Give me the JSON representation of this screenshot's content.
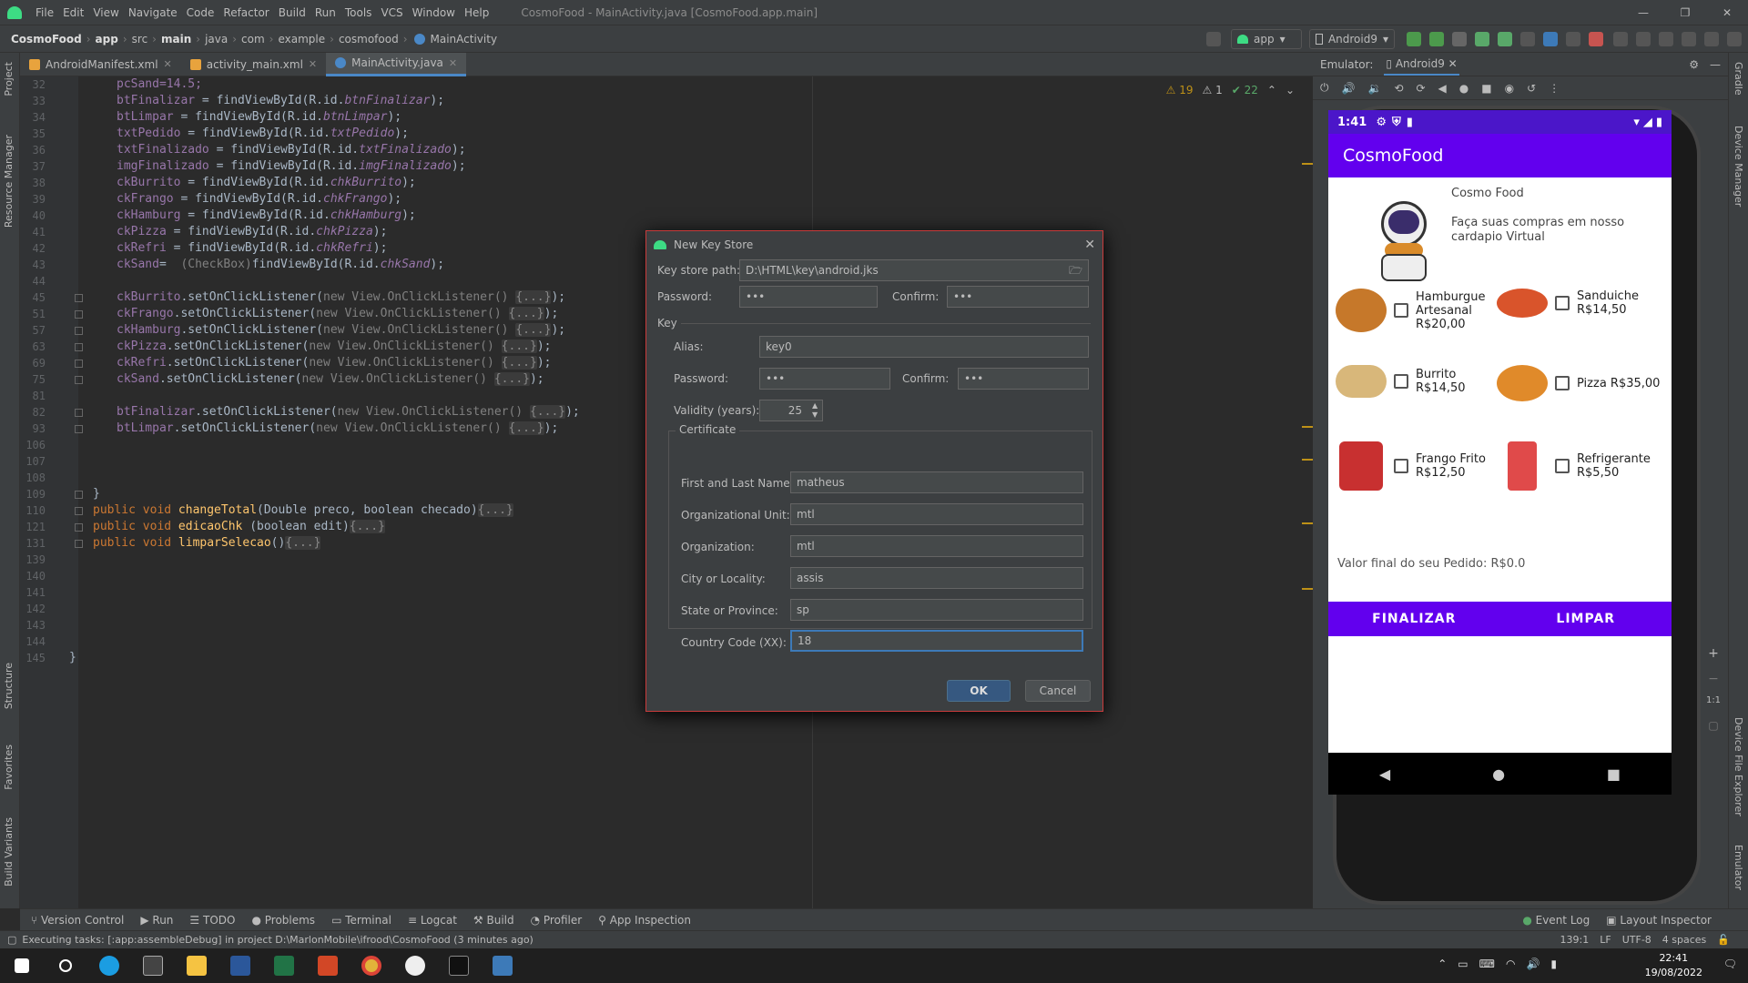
{
  "menubar": {
    "items": [
      "File",
      "Edit",
      "View",
      "Navigate",
      "Code",
      "Refactor",
      "Build",
      "Run",
      "Tools",
      "VCS",
      "Window",
      "Help"
    ],
    "title": "CosmoFood - MainActivity.java [CosmoFood.app.main]",
    "min": "—",
    "max": "❐",
    "close": "✕"
  },
  "breadcrumb": [
    "CosmoFood",
    "app",
    "src",
    "main",
    "java",
    "com",
    "example",
    "cosmofood",
    "MainActivity"
  ],
  "run_config": {
    "module": "app",
    "device": "Android9"
  },
  "file_tabs": [
    "AndroidManifest.xml",
    "activity_main.xml",
    "MainActivity.java"
  ],
  "left_tools": [
    "Project",
    "Resource Manager",
    "Structure",
    "Favorites",
    "Build Variants"
  ],
  "right_tools": [
    "Gradle",
    "Device Manager",
    "Device File Explorer",
    "Emulator"
  ],
  "inspections": {
    "warnings": "19",
    "weak": "1",
    "ok": "22"
  },
  "code_lines": [
    {
      "n": "32",
      "t": "pcSand=14.5;"
    },
    {
      "n": "33",
      "a": "btFinalizar",
      "b": "btnFinalizar"
    },
    {
      "n": "34",
      "a": "btLimpar",
      "b": "btnLimpar"
    },
    {
      "n": "35",
      "a": "txtPedido",
      "b": "txtPedido"
    },
    {
      "n": "36",
      "a": "txtFinalizado",
      "b": "txtFinalizado"
    },
    {
      "n": "37",
      "a": "imgFinalizado",
      "b": "imgFinalizado"
    },
    {
      "n": "38",
      "a": "ckBurrito",
      "b": "chkBurrito"
    },
    {
      "n": "39",
      "a": "ckFrango",
      "b": "chkFrango"
    },
    {
      "n": "40",
      "a": "ckHamburg",
      "b": "chkHamburg"
    },
    {
      "n": "41",
      "a": "ckPizza",
      "b": "chkPizza"
    },
    {
      "n": "42",
      "a": "ckRefri",
      "b": "chkRefri"
    },
    {
      "n": "43",
      "a": "ckSand",
      "b": "chkSand",
      "cast": true
    }
  ],
  "listener_lines": [
    {
      "n": "45",
      "v": "ckBurrito"
    },
    {
      "n": "51",
      "v": "ckFrango"
    },
    {
      "n": "57",
      "v": "ckHamburg"
    },
    {
      "n": "63",
      "v": "ckPizza"
    },
    {
      "n": "69",
      "v": "ckRefri"
    },
    {
      "n": "75",
      "v": "ckSand"
    },
    {
      "n": "81",
      "v": ""
    },
    {
      "n": "82",
      "v": "btFinalizar"
    },
    {
      "n": "93",
      "v": "btLimpar"
    }
  ],
  "empty_lines_top": [
    "44"
  ],
  "after_lines": [
    "106",
    "107",
    "108"
  ],
  "method_lines": [
    {
      "n": "110",
      "sig": "changeTotal",
      "args": "(Double preco, boolean checado)"
    },
    {
      "n": "121",
      "sig": "edicaoChk",
      "args": " (boolean edit)"
    },
    {
      "n": "131",
      "sig": "limparSelecao",
      "args": "()"
    }
  ],
  "closing_lines": {
    "n109": "109",
    "n139": "139",
    "rest": [
      "140",
      "141",
      "142",
      "143",
      "144"
    ],
    "n145": "145"
  },
  "emulator": {
    "label": "Emulator:",
    "device": "Android9",
    "time": "1:41",
    "app_title": "CosmoFood",
    "brand": "Cosmo Food",
    "tagline": "Faça suas compras em nosso cardapio Virtual",
    "items": [
      {
        "name": "Hamburgue Artesanal R$20,00",
        "color": "#c6782a"
      },
      {
        "name": "Sanduiche R$14,50",
        "color": "#d9542b"
      },
      {
        "name": "Burrito R$14,50",
        "color": "#d8b77a"
      },
      {
        "name": "Pizza R$35,00",
        "color": "#e08a2a"
      },
      {
        "name": "Frango Frito R$12,50",
        "color": "#c83030"
      },
      {
        "name": "Refrigerante R$5,50",
        "color": "#e04a4a"
      }
    ],
    "total": "Valor final do seu Pedido: R$0.0",
    "btn_finalizar": "FINALIZAR",
    "btn_limpar": "LIMPAR",
    "zoom_ratio": "1:1"
  },
  "dialog": {
    "title": "New Key Store",
    "keystore_label": "Key store path:",
    "keystore_path": "D:\\HTML\\key\\android.jks",
    "password_label": "Password:",
    "password": "•••",
    "confirm_label": "Confirm:",
    "confirm": "•••",
    "key_label": "Key",
    "alias_label": "Alias:",
    "alias": "key0",
    "key_password": "•••",
    "key_confirm": "•••",
    "validity_label": "Validity (years):",
    "validity": "25",
    "certificate_label": "Certificate",
    "first_last_label": "First and Last Name:",
    "first_last": "matheus",
    "org_unit_label": "Organizational Unit:",
    "org_unit": "mtl",
    "org_label": "Organization:",
    "org": "mtl",
    "city_label": "City or Locality:",
    "city": "assis",
    "state_label": "State or Province:",
    "state": "sp",
    "country_label": "Country Code (XX):",
    "country": "18",
    "ok": "OK",
    "cancel": "Cancel"
  },
  "tool_windows": [
    "Version Control",
    "Run",
    "TODO",
    "Problems",
    "Terminal",
    "Logcat",
    "Build",
    "Profiler",
    "App Inspection"
  ],
  "tool_windows_right": [
    "Event Log",
    "Layout Inspector"
  ],
  "status": {
    "message": "Executing tasks: [:app:assembleDebug] in project D:\\MarlonMobile\\ifrood\\CosmoFood (3 minutes ago)",
    "position": "139:1",
    "line_sep": "LF",
    "encoding": "UTF-8",
    "indent": "4 spaces"
  },
  "taskbar": {
    "time": "22:41",
    "date": "19/08/2022"
  },
  "colors": {
    "accent": "#6200ee",
    "statusbar": "#4b16c9",
    "editor_bg": "#2b2b2b",
    "dialog_border": "#c93b3b"
  }
}
